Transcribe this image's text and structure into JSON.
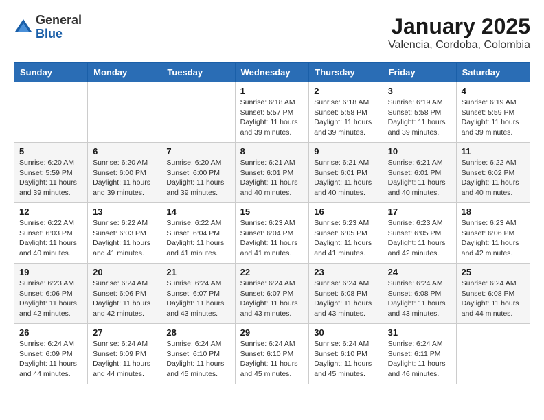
{
  "header": {
    "logo_general": "General",
    "logo_blue": "Blue",
    "title": "January 2025",
    "subtitle": "Valencia, Cordoba, Colombia"
  },
  "calendar": {
    "days_of_week": [
      "Sunday",
      "Monday",
      "Tuesday",
      "Wednesday",
      "Thursday",
      "Friday",
      "Saturday"
    ],
    "weeks": [
      [
        {
          "day": "",
          "info": ""
        },
        {
          "day": "",
          "info": ""
        },
        {
          "day": "",
          "info": ""
        },
        {
          "day": "1",
          "info": "Sunrise: 6:18 AM\nSunset: 5:57 PM\nDaylight: 11 hours and 39 minutes."
        },
        {
          "day": "2",
          "info": "Sunrise: 6:18 AM\nSunset: 5:58 PM\nDaylight: 11 hours and 39 minutes."
        },
        {
          "day": "3",
          "info": "Sunrise: 6:19 AM\nSunset: 5:58 PM\nDaylight: 11 hours and 39 minutes."
        },
        {
          "day": "4",
          "info": "Sunrise: 6:19 AM\nSunset: 5:59 PM\nDaylight: 11 hours and 39 minutes."
        }
      ],
      [
        {
          "day": "5",
          "info": "Sunrise: 6:20 AM\nSunset: 5:59 PM\nDaylight: 11 hours and 39 minutes."
        },
        {
          "day": "6",
          "info": "Sunrise: 6:20 AM\nSunset: 6:00 PM\nDaylight: 11 hours and 39 minutes."
        },
        {
          "day": "7",
          "info": "Sunrise: 6:20 AM\nSunset: 6:00 PM\nDaylight: 11 hours and 39 minutes."
        },
        {
          "day": "8",
          "info": "Sunrise: 6:21 AM\nSunset: 6:01 PM\nDaylight: 11 hours and 40 minutes."
        },
        {
          "day": "9",
          "info": "Sunrise: 6:21 AM\nSunset: 6:01 PM\nDaylight: 11 hours and 40 minutes."
        },
        {
          "day": "10",
          "info": "Sunrise: 6:21 AM\nSunset: 6:01 PM\nDaylight: 11 hours and 40 minutes."
        },
        {
          "day": "11",
          "info": "Sunrise: 6:22 AM\nSunset: 6:02 PM\nDaylight: 11 hours and 40 minutes."
        }
      ],
      [
        {
          "day": "12",
          "info": "Sunrise: 6:22 AM\nSunset: 6:03 PM\nDaylight: 11 hours and 40 minutes."
        },
        {
          "day": "13",
          "info": "Sunrise: 6:22 AM\nSunset: 6:03 PM\nDaylight: 11 hours and 41 minutes."
        },
        {
          "day": "14",
          "info": "Sunrise: 6:22 AM\nSunset: 6:04 PM\nDaylight: 11 hours and 41 minutes."
        },
        {
          "day": "15",
          "info": "Sunrise: 6:23 AM\nSunset: 6:04 PM\nDaylight: 11 hours and 41 minutes."
        },
        {
          "day": "16",
          "info": "Sunrise: 6:23 AM\nSunset: 6:05 PM\nDaylight: 11 hours and 41 minutes."
        },
        {
          "day": "17",
          "info": "Sunrise: 6:23 AM\nSunset: 6:05 PM\nDaylight: 11 hours and 42 minutes."
        },
        {
          "day": "18",
          "info": "Sunrise: 6:23 AM\nSunset: 6:06 PM\nDaylight: 11 hours and 42 minutes."
        }
      ],
      [
        {
          "day": "19",
          "info": "Sunrise: 6:23 AM\nSunset: 6:06 PM\nDaylight: 11 hours and 42 minutes."
        },
        {
          "day": "20",
          "info": "Sunrise: 6:24 AM\nSunset: 6:06 PM\nDaylight: 11 hours and 42 minutes."
        },
        {
          "day": "21",
          "info": "Sunrise: 6:24 AM\nSunset: 6:07 PM\nDaylight: 11 hours and 43 minutes."
        },
        {
          "day": "22",
          "info": "Sunrise: 6:24 AM\nSunset: 6:07 PM\nDaylight: 11 hours and 43 minutes."
        },
        {
          "day": "23",
          "info": "Sunrise: 6:24 AM\nSunset: 6:08 PM\nDaylight: 11 hours and 43 minutes."
        },
        {
          "day": "24",
          "info": "Sunrise: 6:24 AM\nSunset: 6:08 PM\nDaylight: 11 hours and 43 minutes."
        },
        {
          "day": "25",
          "info": "Sunrise: 6:24 AM\nSunset: 6:08 PM\nDaylight: 11 hours and 44 minutes."
        }
      ],
      [
        {
          "day": "26",
          "info": "Sunrise: 6:24 AM\nSunset: 6:09 PM\nDaylight: 11 hours and 44 minutes."
        },
        {
          "day": "27",
          "info": "Sunrise: 6:24 AM\nSunset: 6:09 PM\nDaylight: 11 hours and 44 minutes."
        },
        {
          "day": "28",
          "info": "Sunrise: 6:24 AM\nSunset: 6:10 PM\nDaylight: 11 hours and 45 minutes."
        },
        {
          "day": "29",
          "info": "Sunrise: 6:24 AM\nSunset: 6:10 PM\nDaylight: 11 hours and 45 minutes."
        },
        {
          "day": "30",
          "info": "Sunrise: 6:24 AM\nSunset: 6:10 PM\nDaylight: 11 hours and 45 minutes."
        },
        {
          "day": "31",
          "info": "Sunrise: 6:24 AM\nSunset: 6:11 PM\nDaylight: 11 hours and 46 minutes."
        },
        {
          "day": "",
          "info": ""
        }
      ]
    ]
  }
}
